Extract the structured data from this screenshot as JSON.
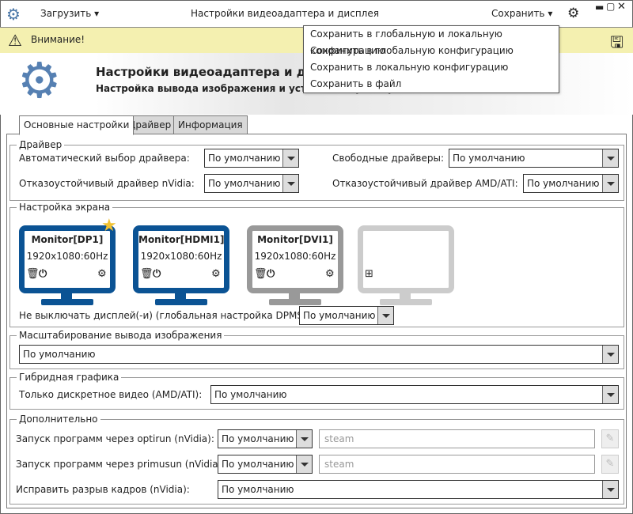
{
  "titlebar": {
    "load": "Загрузить",
    "title": "Настройки видеоадаптера и дисплея",
    "save": "Сохранить"
  },
  "save_menu": [
    "Сохранить в глобальную и локальную конфигурацию",
    "Сохранить в глобальную конфигурацию",
    "Сохранить в локальную конфигурацию",
    "Сохранить в файл"
  ],
  "warning": "Внимание!",
  "banner": {
    "title": "Настройки видеоадаптера и дисплея",
    "subtitle": "Настройка вывода изображения и установка драйверов видеоадаптера"
  },
  "tabs": [
    "Основные настройки",
    "Драйвер",
    "Информация"
  ],
  "driver": {
    "title": "Драйвер",
    "auto_label": "Автоматический выбор драйвера:",
    "auto_value": "По умолчанию",
    "free_label": "Свободные драйверы:",
    "free_value": "По умолчанию",
    "nvidia_label": "Отказоустойчивый драйвер nVidia:",
    "nvidia_value": "По умолчанию",
    "amd_label": "Отказоустойчивый драйвер AMD/ATI:",
    "amd_value": "По умолчанию"
  },
  "screen": {
    "title": "Настройка экрана",
    "monitors": [
      {
        "name": "Monitor[DP1]",
        "res": "1920x1080:60Hz"
      },
      {
        "name": "Monitor[HDMI1]",
        "res": "1920x1080:60Hz"
      },
      {
        "name": "Monitor[DVI1]",
        "res": "1920x1080:60Hz"
      }
    ],
    "dpms_label": "Не выключать дисплей(-и) (глобальная настройка DPMS):",
    "dpms_value": "По умолчанию"
  },
  "scaling": {
    "title": "Масштабирование вывода изображения",
    "value": "По умолчанию"
  },
  "hybrid": {
    "title": "Гибридная графика",
    "label": "Только дискретное видео (AMD/ATI):",
    "value": "По умолчанию"
  },
  "extra": {
    "title": "Дополнительно",
    "optirun_label": "Запуск программ через optirun (nVidia):",
    "optirun_value": "По умолчанию",
    "optirun_input": "steam",
    "primusun_label": "Запуск программ через primusun (nVidia):",
    "primusun_value": "По умолчанию",
    "primusun_input": "steam",
    "tearing_label": "Исправить разрыв кадров (nVidia):",
    "tearing_value": "По умолчанию"
  },
  "colors": {
    "accent": "#0b5394",
    "gray_monitor": "#999999",
    "empty_monitor": "#cccccc",
    "warning_bg": "#f4f0b0",
    "star": "#f1c232"
  }
}
